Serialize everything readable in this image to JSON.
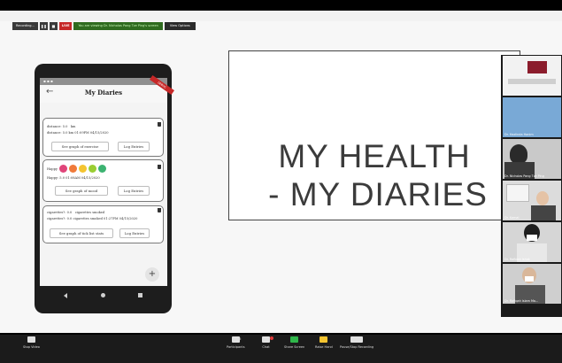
{
  "recording_bar": {
    "recording_label": "Recording...",
    "live_label": "LIVE",
    "viewing_label": "You are viewing Dr. Nicholas Pang Tze Ping's screen",
    "view_options_label": "View Options"
  },
  "phone_app": {
    "status_time": "",
    "title": "My Diaries",
    "debug_label": "DEBUG",
    "cards": [
      {
        "line1_label": "distance: 5.0",
        "line1_unit": "km",
        "line2": "distance: 5.0 km 01:09PM 04/15/2020",
        "left_button": "See graph of exercise",
        "right_button": "Log Entries"
      },
      {
        "line1_label": "Happy",
        "line2": "Happy: 5.0 01:08AM 04/15/2020",
        "left_button": "See graph of mood",
        "right_button": "Log Entries"
      },
      {
        "line1_label": "cigarettes?: 0.0",
        "line1_unit": "cigarettes smoked",
        "line2": "cigarettes?: 0.0 cigarettes smoked 01:27PM 04/15/2020",
        "left_button": "See graph of tick list stats",
        "right_button": "Log Entries"
      }
    ],
    "fab_label": "+",
    "mood_colors": [
      "#e0457a",
      "#f07a3a",
      "#f4c430",
      "#9acd32",
      "#3cb371"
    ]
  },
  "slide": {
    "line1": "MY HEALTH",
    "line2": "- MY DIARIES"
  },
  "gallery": [
    {
      "name": "",
      "bg": "#f2f2f2"
    },
    {
      "name": "Dr. Hazlinda Hanim",
      "bg": "#8fb6d9"
    },
    {
      "name": "Dr. Nicholas Pang Tze Ping",
      "bg": "#c9c9c9"
    },
    {
      "name": "Dr. Kamal",
      "bg": "#dcdcdc"
    },
    {
      "name": "Dr. Rafidah Ishak",
      "bg": "#d6d6d6"
    },
    {
      "name": "Dr. Rafiqah Islam Ma...",
      "bg": "#cfcfcf"
    }
  ],
  "toolbar": {
    "stop_video": "Stop Video",
    "participants": "Participants",
    "participants_count": "35",
    "chat": "Chat",
    "share_screen": "Share Screen",
    "raise_hand": "Raise Hand",
    "pause_recording": "Pause/Stop Recording"
  }
}
